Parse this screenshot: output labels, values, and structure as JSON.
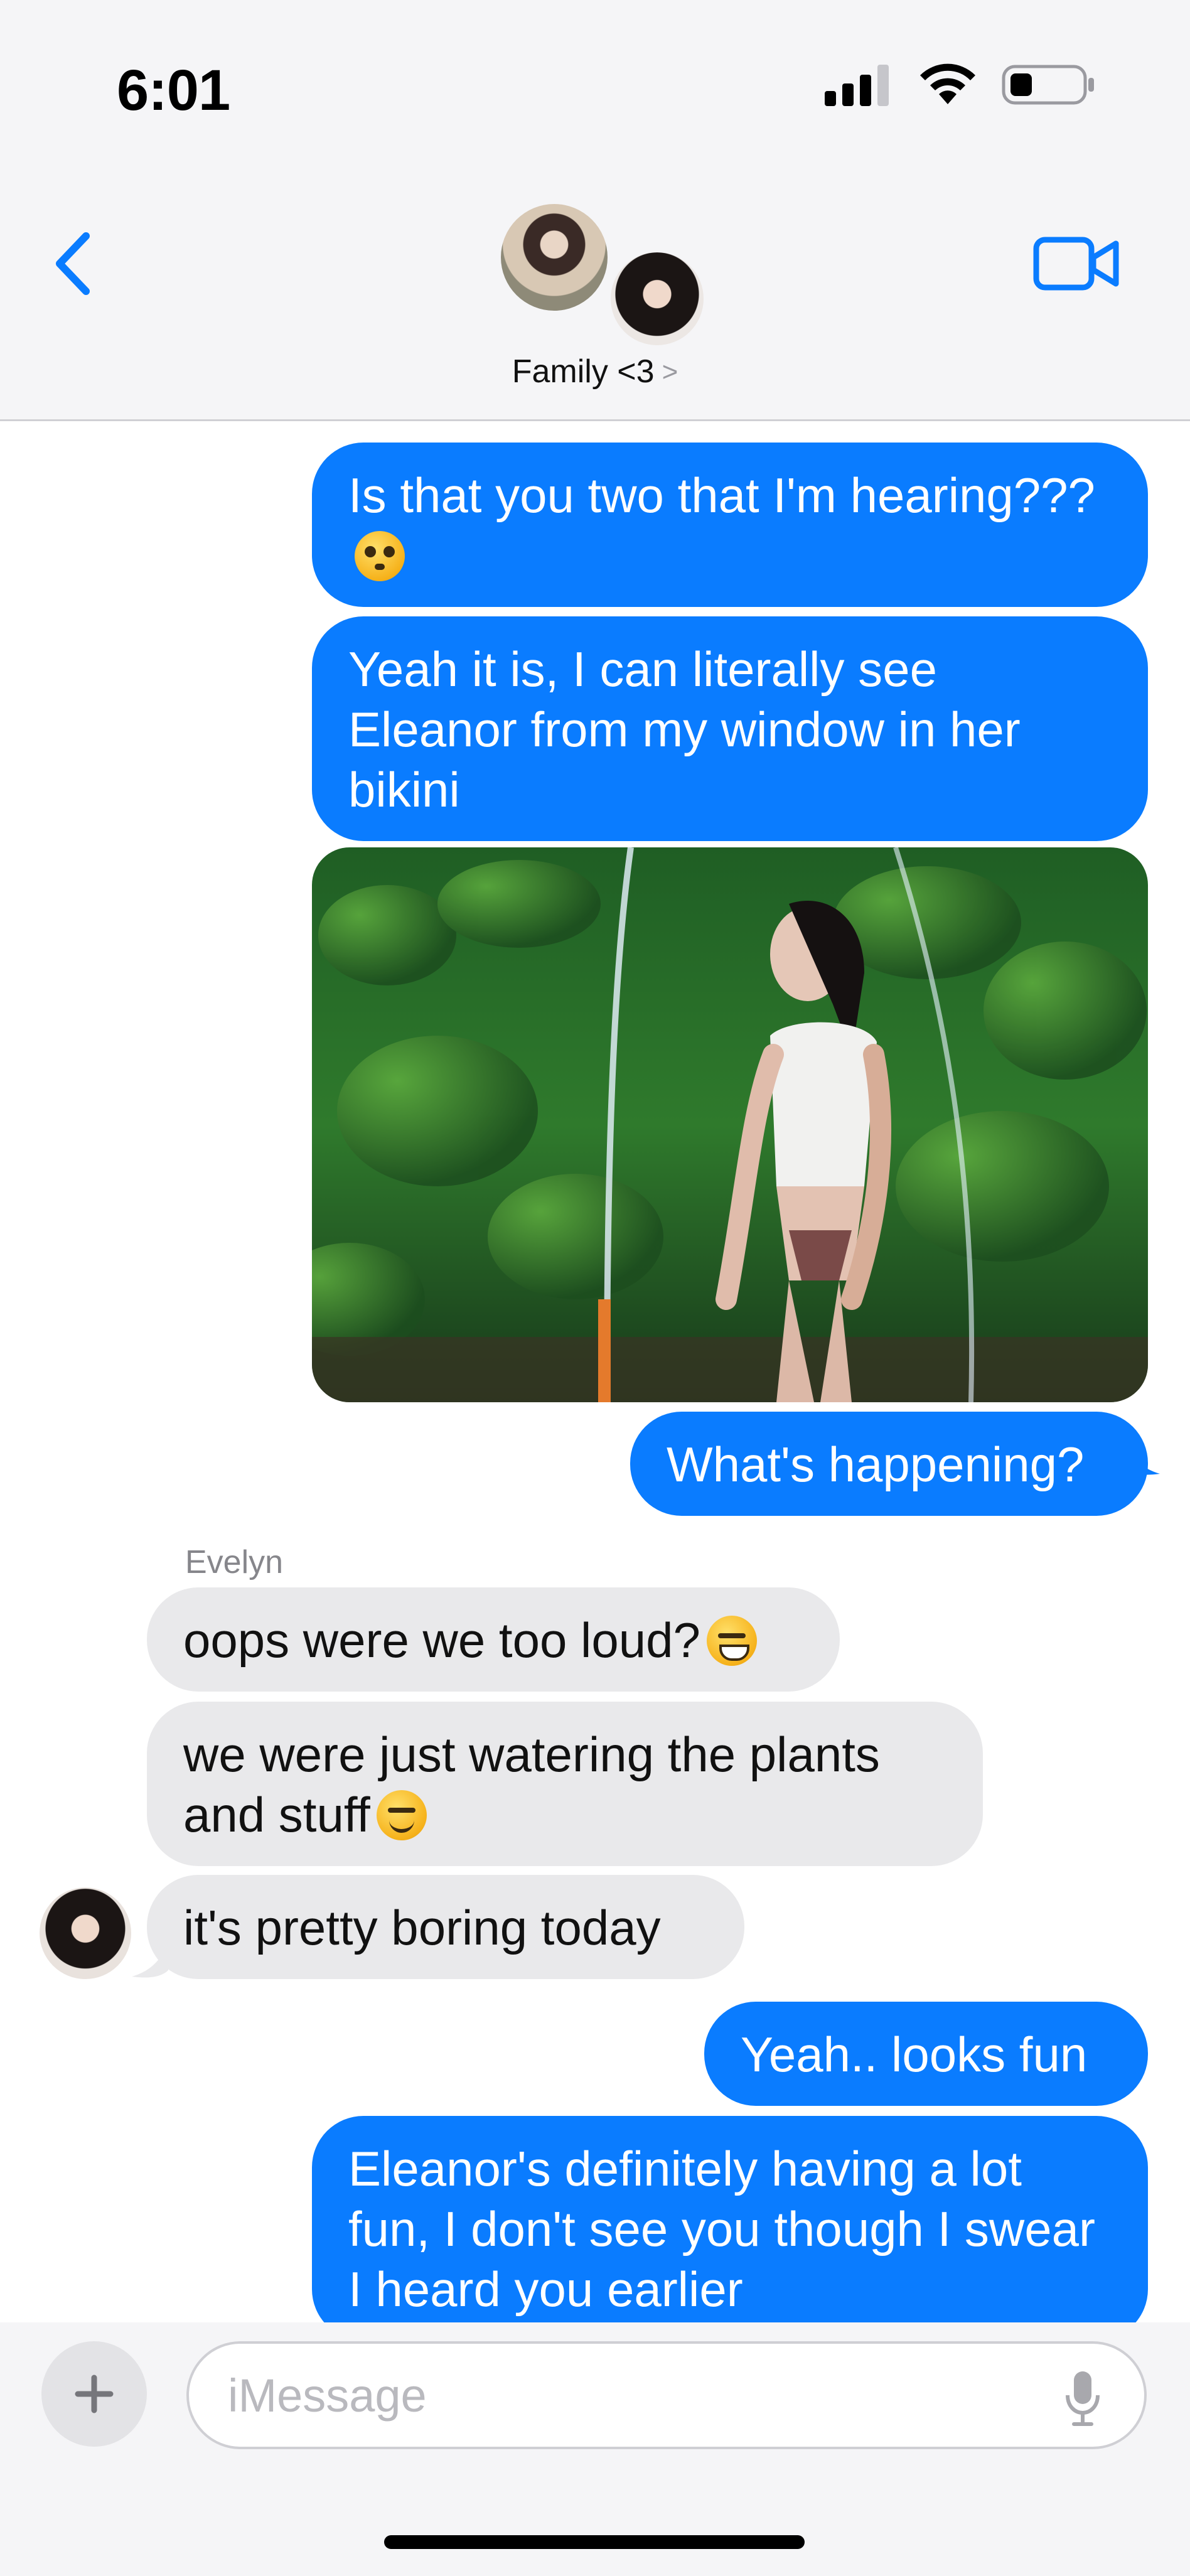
{
  "status_bar": {
    "time": "6:01",
    "icons": [
      "cellular-signal-icon",
      "wifi-icon",
      "battery-icon"
    ]
  },
  "header": {
    "back_icon": "chevron-left-icon",
    "chat_name": "Family <3",
    "chevron": ">",
    "video_icon": "video-camera-icon",
    "accent": "#0a7cff"
  },
  "messages": [
    {
      "direction": "out",
      "text": "Is that you two that I'm hearing???",
      "emoji": "flushed-face"
    },
    {
      "direction": "out",
      "text": "Yeah it is, I can literally see Eleanor from my window in her bikini"
    },
    {
      "direction": "out",
      "type": "photo",
      "description_icon": "photo-attachment"
    },
    {
      "direction": "out",
      "text": "What's happening?"
    },
    {
      "direction": "in",
      "sender": "Evelyn",
      "text": "oops were we too loud?",
      "emoji": "grinning-sweat-face"
    },
    {
      "direction": "in",
      "text": "we were just watering the plants and stuff",
      "emoji": "smiling-face"
    },
    {
      "direction": "in",
      "text": "it's pretty boring today"
    },
    {
      "direction": "out",
      "text": "Yeah.. looks fun"
    },
    {
      "direction": "out",
      "text": "Eleanor's definitely having a lot fun, I don't see you though I swear I heard you earlier"
    }
  ],
  "composer": {
    "placeholder": "iMessage",
    "plus_icon": "plus-icon",
    "mic_icon": "microphone-icon"
  },
  "colors": {
    "outgoing_bubble": "#0a7cff",
    "incoming_bubble": "#e9e9eb",
    "header_bg": "#f5f5f7"
  }
}
